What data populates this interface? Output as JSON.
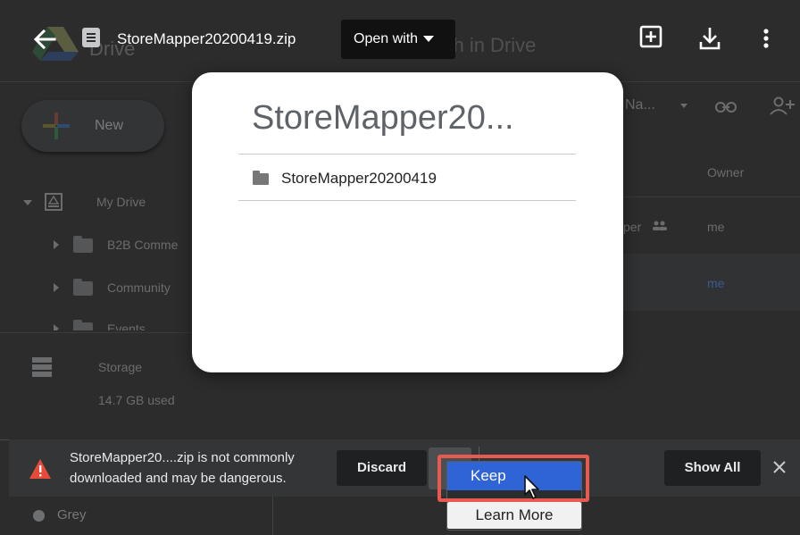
{
  "background": {
    "app_word": "Drive",
    "search_hint": "Search in Drive",
    "new_button": "New",
    "sidebar": {
      "my_drive": "My Drive",
      "folders": [
        "B2B Comme",
        "Community",
        "Events"
      ],
      "storage_label": "Storage",
      "storage_used": "14.7 GB used"
    },
    "list": {
      "name_col_fragment": "Na...",
      "owner_col": "Owner",
      "row1_name_fragment": "per",
      "row1_owner": "me",
      "row2_owner": "me"
    },
    "label_row": "Grey"
  },
  "viewer": {
    "file_name": "StoreMapper20200419.zip",
    "open_with": "Open with"
  },
  "preview": {
    "title": "StoreMapper20...",
    "folder_name": "StoreMapper20200419"
  },
  "download_shelf": {
    "warning_line1": "StoreMapper20....zip is not commonly",
    "warning_line2": "downloaded and may be dangerous.",
    "discard": "Discard",
    "show_all": "Show All"
  },
  "context_menu": {
    "keep": "Keep",
    "learn_more": "Learn More"
  },
  "colors": {
    "keep_highlight": "#2f64d6",
    "annotation_border": "#e85a4f",
    "warning_red": "#e84a3a"
  },
  "icons": [
    "back-arrow-icon",
    "zip-file-icon",
    "add-shortcut-icon",
    "download-icon",
    "more-vert-icon",
    "folder-icon",
    "warning-icon",
    "close-icon",
    "mouse-cursor-icon"
  ]
}
